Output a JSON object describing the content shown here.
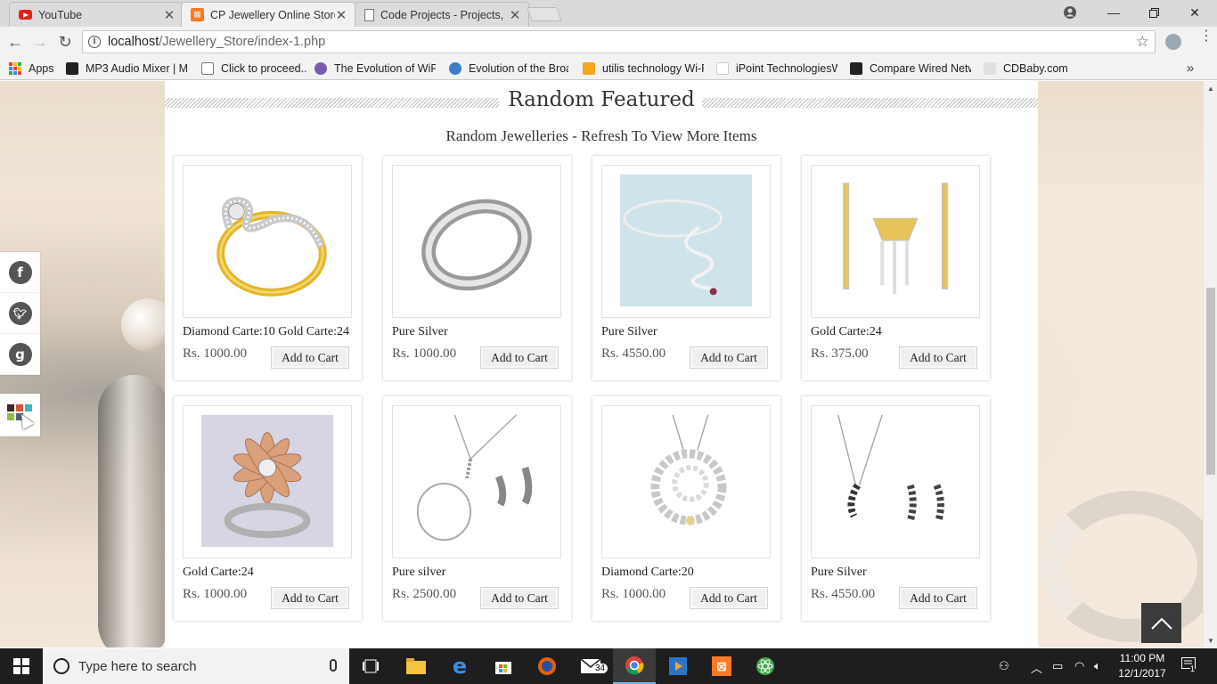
{
  "browser": {
    "tabs": [
      {
        "title": "YouTube",
        "active": false
      },
      {
        "title": "CP Jewellery Online Store",
        "active": true
      },
      {
        "title": "Code Projects - Projects,",
        "active": false
      }
    ],
    "url_host": "localhost",
    "url_path": "/Jewellery_Store/index-1.php",
    "bookmarks": [
      "Apps",
      "MP3 Audio Mixer | M",
      "Click to proceed...",
      "The Evolution of WiFi",
      "Evolution of the Broa",
      "utilis technology Wi-F",
      "iPoint TechnologiesW",
      "Compare Wired Netw",
      "CDBaby.com"
    ]
  },
  "page": {
    "section_title": "Random Featured",
    "section_subtitle": "Random Jewelleries - Refresh To View More Items",
    "cart_label": "Add to Cart",
    "products": [
      {
        "name": "Diamond Carte:10 Gold Carte:24",
        "price": "Rs. 1000.00",
        "image": "gold-diamond-ring"
      },
      {
        "name": "Pure Silver",
        "price": "Rs. 1000.00",
        "image": "silver-band-ring"
      },
      {
        "name": "Pure Silver",
        "price": "Rs. 4550.00",
        "image": "silver-snake-bangle"
      },
      {
        "name": "Gold Carte:24",
        "price": "Rs. 375.00",
        "image": "gold-pendant-earring-set"
      },
      {
        "name": "Gold Carte:24",
        "price": "Rs. 1000.00",
        "image": "flower-cocktail-ring"
      },
      {
        "name": "Pure silver",
        "price": "Rs. 2500.00",
        "image": "silver-necklace-bracelet-earrings"
      },
      {
        "name": "Diamond Carte:20",
        "price": "Rs. 1000.00",
        "image": "diamond-spiral-pendant"
      },
      {
        "name": "Pure Silver",
        "price": "Rs. 4550.00",
        "image": "black-diamond-pendant-set"
      }
    ]
  },
  "taskbar": {
    "search_placeholder": "Type here to search",
    "mail_badge": "34",
    "time": "11:00 PM",
    "date": "12/1/2017",
    "notification_count": "1"
  },
  "colors": {
    "accent_blue": "#76b9ed",
    "youtube_red": "#e62117",
    "xampp_orange": "#fb7a24"
  }
}
